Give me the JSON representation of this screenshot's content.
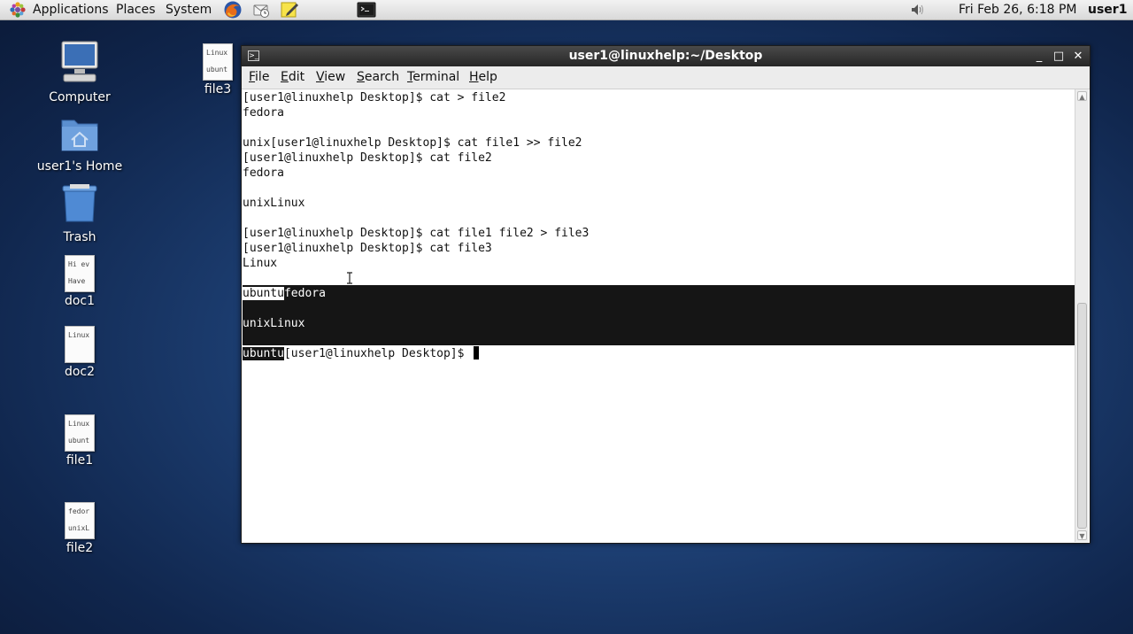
{
  "panel": {
    "menus": [
      "Applications",
      "Places",
      "System"
    ],
    "clock": "Fri Feb 26,  6:18 PM",
    "user": "user1",
    "launchers": [
      "firefox-icon",
      "mail-icon",
      "notes-icon",
      "terminal-icon"
    ],
    "volume_icon": "volume-icon"
  },
  "desktop": {
    "computer": "Computer",
    "home": "user1's Home",
    "trash": "Trash",
    "doc1": {
      "label": "doc1",
      "preview": [
        "Hi ev",
        "Have"
      ]
    },
    "doc2": {
      "label": "doc2",
      "preview": [
        "Linux"
      ]
    },
    "file1": {
      "label": "file1",
      "preview": [
        "Linux",
        "ubunt"
      ]
    },
    "file2": {
      "label": "file2",
      "preview": [
        "fedor",
        "unixL"
      ]
    },
    "file3": {
      "label": "file3",
      "preview": [
        "Linux",
        "ubunt"
      ]
    }
  },
  "window": {
    "title": "user1@linuxhelp:~/Desktop",
    "menu": {
      "file": {
        "u": "F",
        "rest": "ile"
      },
      "edit": {
        "u": "E",
        "rest": "dit"
      },
      "view": {
        "u": "V",
        "rest": "iew"
      },
      "search": {
        "u": "S",
        "rest": "earch"
      },
      "terminal": {
        "u": "T",
        "rest": "erminal"
      },
      "help": {
        "u": "H",
        "rest": "elp"
      }
    },
    "controls": {
      "minimize": "_",
      "maximize": "□",
      "close": "✕"
    }
  },
  "terminal": {
    "l0": "[user1@linuxhelp Desktop]$ cat > file2",
    "l1": "fedora",
    "l2": "",
    "l3": "unix[user1@linuxhelp Desktop]$ cat file1 >> file2",
    "l4": "[user1@linuxhelp Desktop]$ cat file2",
    "l5": "fedora",
    "l6": "",
    "l7": "unixLinux",
    "l8": "",
    "l9": "[user1@linuxhelp Desktop]$ cat file1 file2 > file3",
    "l10": "[user1@linuxhelp Desktop]$ cat file3",
    "l11": "Linux",
    "l12": "",
    "l13a": "ubuntu",
    "l13b": "fedora",
    "l14": "",
    "l15": "unixLinux",
    "l16": "",
    "l17a": "ubuntu",
    "l17b": "[user1@linuxhelp Desktop]$ "
  }
}
